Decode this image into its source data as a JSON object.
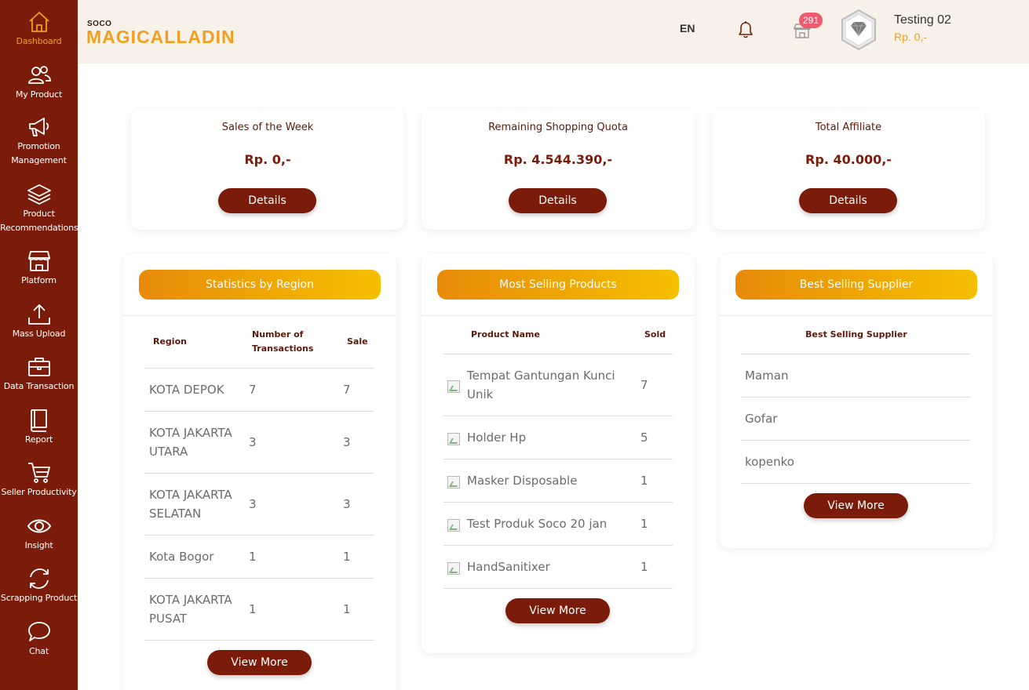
{
  "sidebar": {
    "items": [
      {
        "label": "Dashboard",
        "icon": "home-icon"
      },
      {
        "label": "My Product",
        "icon": "users-icon"
      },
      {
        "label": "Promotion Management",
        "icon": "megaphone-icon"
      },
      {
        "label": "Product Recommendations",
        "icon": "layers-icon"
      },
      {
        "label": "Platform",
        "icon": "store-icon"
      },
      {
        "label": "Mass Upload",
        "icon": "upload-icon"
      },
      {
        "label": "Data Transaction",
        "icon": "briefcase-icon"
      },
      {
        "label": "Report",
        "icon": "book-icon"
      },
      {
        "label": "Seller Productivity",
        "icon": "cart-icon"
      },
      {
        "label": "Insight",
        "icon": "eye-icon"
      },
      {
        "label": "Scrapping Product",
        "icon": "refresh-icon"
      },
      {
        "label": "Chat",
        "icon": "chat-icon"
      }
    ]
  },
  "header": {
    "logo_small": "SOCO",
    "logo_main": "MAGICALLADIN",
    "language": "EN",
    "notification_count": "291",
    "user_name": "Testing 02",
    "user_balance": "Rp. 0,-"
  },
  "summary_cards": [
    {
      "title": "Sales of the Week",
      "value": "Rp. 0,-",
      "button": "Details"
    },
    {
      "title": "Remaining Shopping Quota",
      "value": "Rp. 4.544.390,-",
      "button": "Details"
    },
    {
      "title": "Total Affiliate",
      "value": "Rp. 40.000,-",
      "button": "Details"
    }
  ],
  "region_panel": {
    "title": "Statistics by Region",
    "headers": [
      "Region",
      "Number of Transactions",
      "Sale"
    ],
    "rows": [
      {
        "region": "KOTA DEPOK",
        "transactions": "7",
        "sale": "7"
      },
      {
        "region": "KOTA JAKARTA UTARA",
        "transactions": "3",
        "sale": "3"
      },
      {
        "region": "KOTA JAKARTA SELATAN",
        "transactions": "3",
        "sale": "3"
      },
      {
        "region": "Kota Bogor",
        "transactions": "1",
        "sale": "1"
      },
      {
        "region": "KOTA JAKARTA PUSAT",
        "transactions": "1",
        "sale": "1"
      }
    ],
    "button": "View More"
  },
  "products_panel": {
    "title": "Most Selling Products",
    "headers": [
      "Product Name",
      "Sold"
    ],
    "rows": [
      {
        "name": "Tempat Gantungan Kunci Unik",
        "sold": "7"
      },
      {
        "name": "Holder Hp",
        "sold": "5"
      },
      {
        "name": "Masker Disposable",
        "sold": "1"
      },
      {
        "name": "Test Produk Soco 20 jan",
        "sold": "1"
      },
      {
        "name": "HandSanitixer",
        "sold": "1"
      }
    ],
    "button": "View More"
  },
  "supplier_panel": {
    "title": "Best Selling Supplier",
    "header": "Best Selling Supplier",
    "rows": [
      "Maman",
      "Gofar",
      "kopenko"
    ],
    "button": "View More"
  },
  "colors": {
    "sidebar_bg": "#7b1c0a",
    "accent": "#f0a020",
    "header_bg": "#f7f1e9",
    "badge": "#f05a6e"
  }
}
